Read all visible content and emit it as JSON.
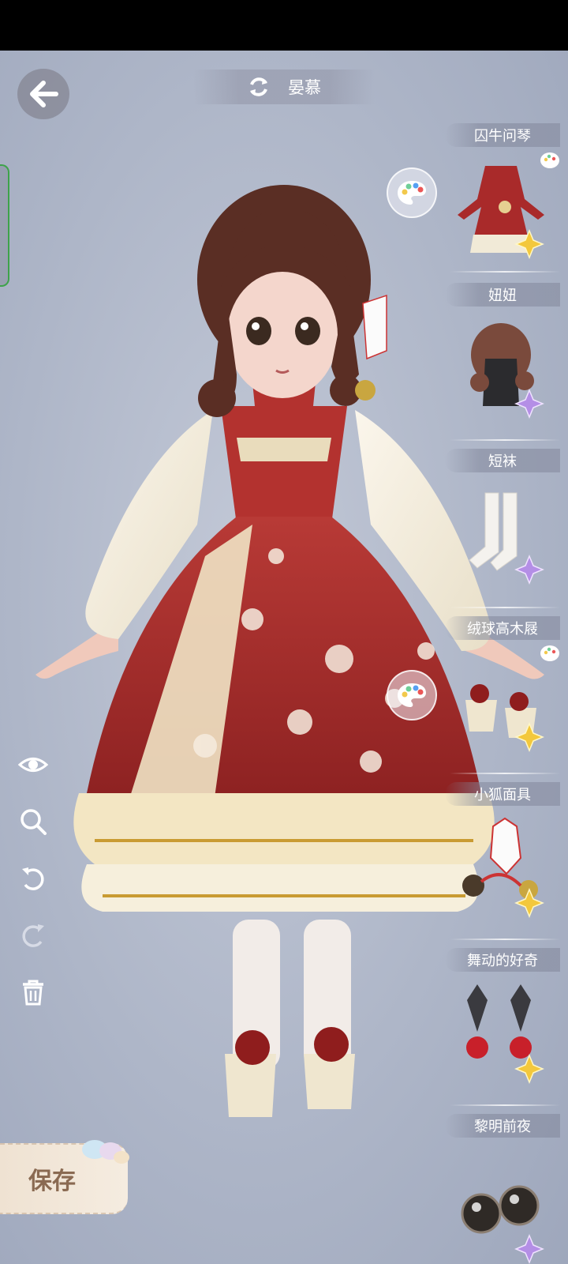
{
  "header": {
    "title": "晏慕",
    "back_icon": "arrow-left-icon",
    "refresh_icon": "refresh-icon"
  },
  "tools": [
    {
      "name": "eye-icon"
    },
    {
      "name": "zoom-icon"
    },
    {
      "name": "undo-icon"
    },
    {
      "name": "redo-icon"
    },
    {
      "name": "trash-icon"
    }
  ],
  "items": [
    {
      "label": "囚牛问琴",
      "kind": "dress",
      "rarity": "gold",
      "has_palette": true
    },
    {
      "label": "妞妞",
      "kind": "hair",
      "rarity": "purple",
      "has_palette": false
    },
    {
      "label": "短袜",
      "kind": "socks",
      "rarity": "purple",
      "has_palette": false
    },
    {
      "label": "绒球高木屐",
      "kind": "shoes",
      "rarity": "gold",
      "has_palette": true
    },
    {
      "label": "小狐面具",
      "kind": "mask",
      "rarity": "gold",
      "has_palette": false
    },
    {
      "label": "舞动的好奇",
      "kind": "earrings",
      "rarity": "gold",
      "has_palette": false
    },
    {
      "label": "黎明前夜",
      "kind": "eyes",
      "rarity": "purple",
      "has_palette": false
    }
  ],
  "save": {
    "label": "保存"
  },
  "colors": {
    "gold_star": "#f3c83c",
    "purple_star": "#b48ee6",
    "dress_red": "#a92a2a",
    "ivory": "#f1ead7"
  }
}
